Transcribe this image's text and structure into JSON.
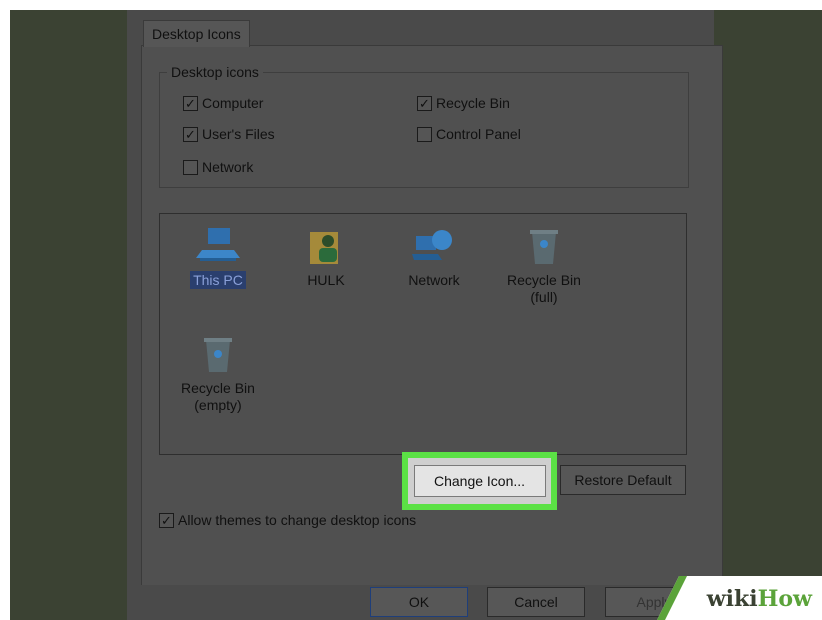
{
  "dialog": {
    "tab_label": "Desktop Icons",
    "group_label": "Desktop icons",
    "checkboxes": [
      {
        "label": "Computer",
        "checked": true
      },
      {
        "label": "User's Files",
        "checked": true
      },
      {
        "label": "Network",
        "checked": false
      },
      {
        "label": "Recycle Bin",
        "checked": true
      },
      {
        "label": "Control Panel",
        "checked": false
      }
    ],
    "icons": [
      {
        "label": "This PC",
        "icon": "computer-icon",
        "selected": true
      },
      {
        "label": "HULK",
        "icon": "user-folder-icon"
      },
      {
        "label": "Network",
        "icon": "network-icon"
      },
      {
        "label": "Recycle Bin\n(full)",
        "line1": "Recycle Bin",
        "line2": "(full)",
        "icon": "recycle-bin-full-icon"
      },
      {
        "line1": "Recycle Bin",
        "line2": "(empty)",
        "icon": "recycle-bin-empty-icon"
      }
    ],
    "buttons": {
      "change_icon": "Change Icon...",
      "restore_default": "Restore Default"
    },
    "allow_themes": {
      "label": "Allow themes to change desktop icons",
      "checked": true
    },
    "footer": {
      "ok": "OK",
      "cancel": "Cancel",
      "apply": "Apply"
    }
  },
  "watermark": {
    "wiki": "wiki",
    "how": "How"
  },
  "colors": {
    "highlight": "#5be145",
    "background": "#3b4233"
  }
}
